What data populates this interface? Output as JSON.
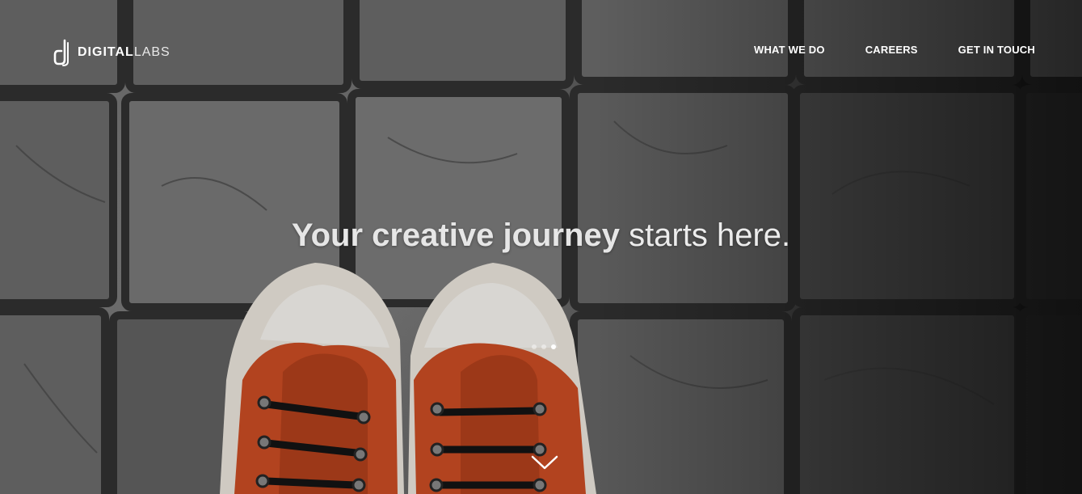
{
  "header": {
    "logo": {
      "strong": "DIGITAL",
      "light": "LABS"
    },
    "nav": [
      {
        "label": "WHAT WE DO"
      },
      {
        "label": "CAREERS"
      },
      {
        "label": "GET IN TOUCH"
      }
    ]
  },
  "hero": {
    "headline_strong": "Your creative journey",
    "headline_light": "starts here.",
    "slides_count": 3,
    "active_slide": 3
  },
  "icons": {
    "logo": "d-logo-icon",
    "scroll": "chevron-down-icon"
  },
  "colors": {
    "text": "#ffffff",
    "shoe": "#b2431f"
  }
}
